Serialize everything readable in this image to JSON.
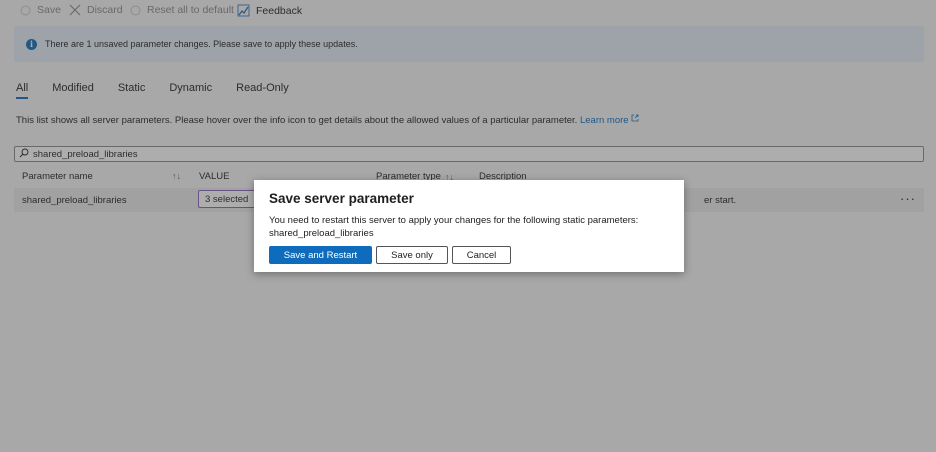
{
  "toolbar": {
    "save_label": "Save",
    "discard_label": "Discard",
    "reset_label": "Reset all to default",
    "feedback_label": "Feedback"
  },
  "banner": {
    "message": "There are 1 unsaved parameter changes.  Please save to apply these updates."
  },
  "tabs": [
    {
      "label": "All",
      "active": true
    },
    {
      "label": "Modified"
    },
    {
      "label": "Static"
    },
    {
      "label": "Dynamic"
    },
    {
      "label": "Read-Only"
    }
  ],
  "description": {
    "text": "This list shows all server parameters. Please hover over the info icon to get details about the allowed values of a particular parameter.",
    "link_label": "Learn more"
  },
  "search": {
    "value": "shared_preload_libraries"
  },
  "table": {
    "headers": {
      "name": "Parameter name",
      "value": "VALUE",
      "type": "Parameter type",
      "description": "Description"
    },
    "rows": [
      {
        "name": "shared_preload_libraries",
        "value": "3 selected",
        "description_tail": "er start."
      }
    ]
  },
  "dialog": {
    "title": "Save server parameter",
    "body_line1": "You need to restart this server to apply your changes for the following static parameters:",
    "body_line2": "shared_preload_libraries",
    "save_restart_label": "Save and Restart",
    "save_only_label": "Save only",
    "cancel_label": "Cancel"
  },
  "colors": {
    "accent": "#0f6cbd",
    "banner_bg": "#e6eefa",
    "value_border": "#8764b8"
  },
  "icons": {
    "save": "spinner-icon",
    "discard": "close-icon",
    "reset": "spinner-icon",
    "feedback": "feedback-icon",
    "info": "info-icon",
    "search": "search-icon",
    "external": "external-link-icon",
    "sort": "sort-arrows-icon",
    "more": "more-icon"
  }
}
